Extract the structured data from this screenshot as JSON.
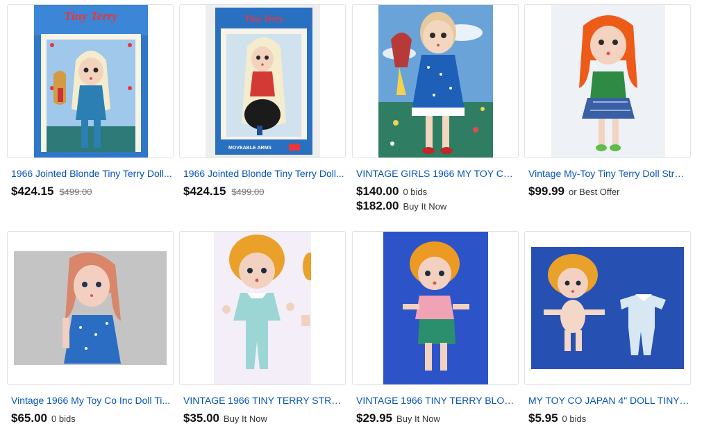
{
  "listings": [
    {
      "title": "1966 Jointed Blonde Tiny Terry Doll...",
      "price": "$424.15",
      "was_price": "$499.00",
      "box_brand": "Tiny Terry"
    },
    {
      "title": "1966 Jointed Blonde Tiny Terry Doll...",
      "price": "$424.15",
      "was_price": "$499.00",
      "box_brand": "Tiny Terry",
      "box_caption": "MOVEABLE ARMS"
    },
    {
      "title": "VINTAGE GIRLS 1966 MY TOY CO...",
      "price": "$140.00",
      "meta": "0 bids",
      "price2": "$182.00",
      "meta2": "Buy It Now"
    },
    {
      "title": "Vintage My-Toy Tiny Terry Doll Strai...",
      "price": "$99.99",
      "meta": "or Best Offer"
    },
    {
      "title": "Vintage 1966 My Toy Co Inc Doll Ti...",
      "price": "$65.00",
      "meta": "0 bids"
    },
    {
      "title": "VINTAGE 1966 TINY TERRY STRA...",
      "price": "$35.00",
      "meta": "Buy It Now"
    },
    {
      "title": "VINTAGE 1966 TINY TERRY BLON...",
      "price": "$29.95",
      "meta": "Buy It Now"
    },
    {
      "title": "MY TOY CO JAPAN 4\" DOLL TINY ...",
      "price": "$5.95",
      "meta": "0 bids"
    }
  ],
  "colors": {
    "link": "#0654ba",
    "price": "#111111",
    "strike": "#767676",
    "border": "#e2e2e2"
  }
}
